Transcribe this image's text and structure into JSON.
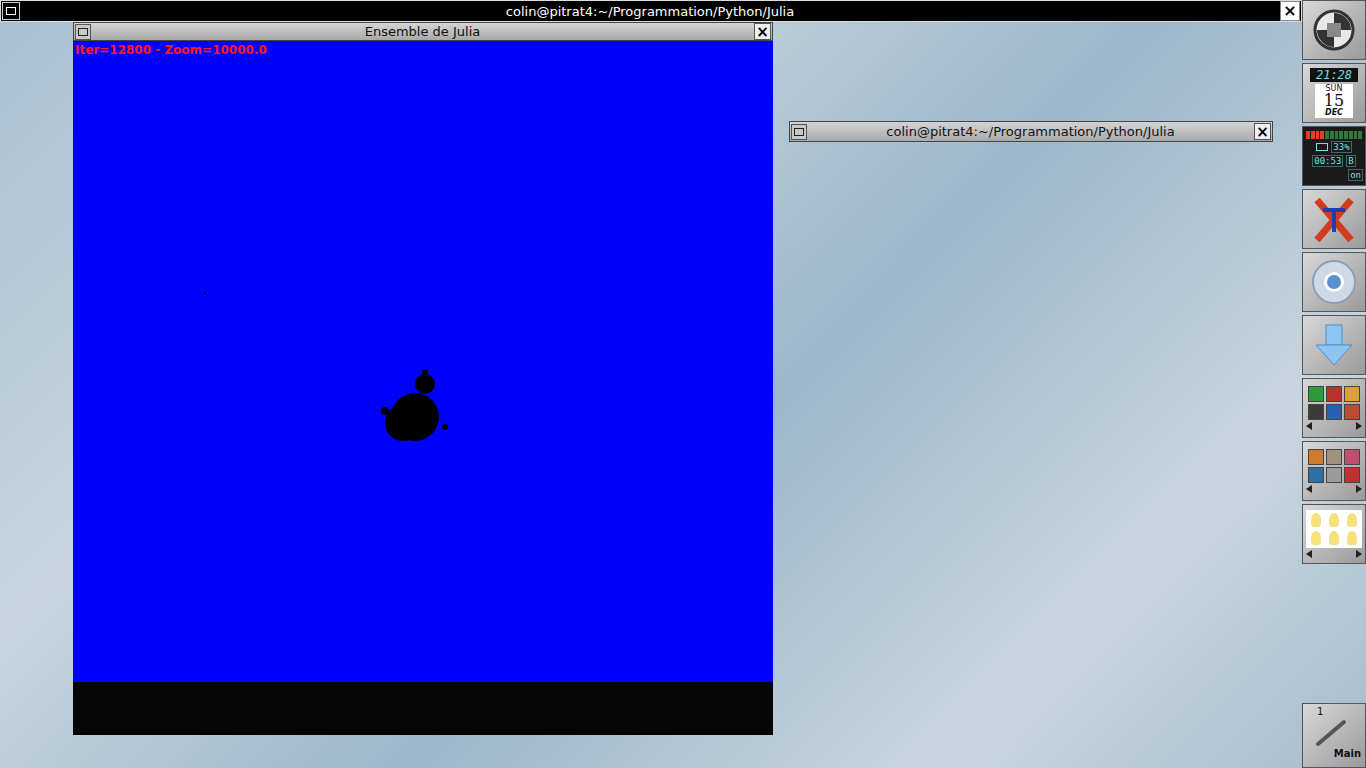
{
  "top_terminal": {
    "title": "colin@pitrat4:~/Programmation/Python/Julia",
    "close": "×"
  },
  "julia_window": {
    "title": "Ensemble de Julia",
    "close": "×",
    "overlay": "Iter=12800 - Zoom=10000.0"
  },
  "shaded_terminal": {
    "title": "colin@pitrat4:~/Programmation/Python/Julia",
    "close": "×"
  },
  "dock": {
    "clock": {
      "time": "21:28",
      "weekday": "SUN",
      "day": "15",
      "month": "DEC"
    },
    "battery": {
      "level": 0.33,
      "percent": "33%",
      "time_left": "00:53",
      "mode": "B",
      "status": "on"
    }
  },
  "workspace": {
    "number": "1",
    "name": "Main"
  }
}
